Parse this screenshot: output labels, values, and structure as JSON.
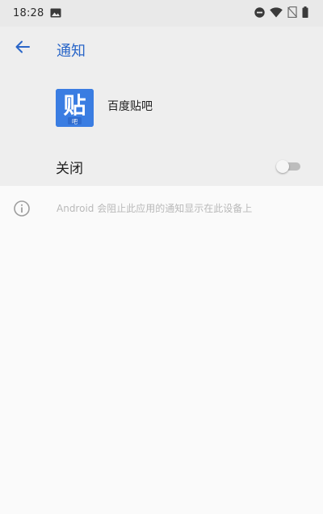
{
  "status_bar": {
    "time": "18:28",
    "icons": [
      "image-icon",
      "do-not-disturb-icon",
      "wifi-icon",
      "no-sim-icon",
      "battery-icon"
    ]
  },
  "header": {
    "back_icon": "arrow-left-icon",
    "title": "通知"
  },
  "app": {
    "icon_char": "贴",
    "icon_sub_char": "吧",
    "name": "百度贴吧"
  },
  "notifications_toggle": {
    "label": "关闭",
    "enabled": false
  },
  "info": {
    "icon": "info-icon",
    "text": "Android 会阻止此应用的通知显示在此设备上"
  },
  "colors": {
    "accent": "#2a66c8",
    "app_icon_bg": "#3a7de2",
    "status_bar_bg": "#e9e9e9",
    "section_bg": "#eeeeee",
    "page_bg": "#fafafa"
  }
}
